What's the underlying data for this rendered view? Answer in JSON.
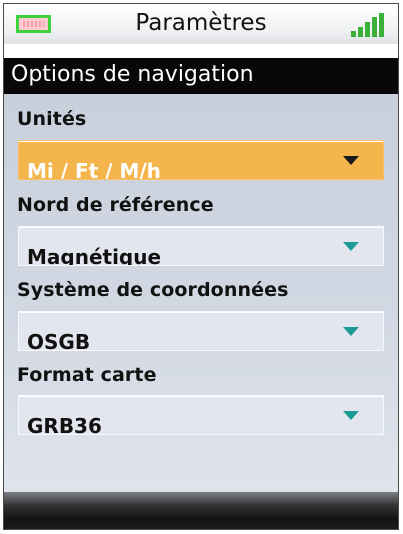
{
  "statusbar": {
    "title": "Paramètres",
    "battery_icon": "battery-icon",
    "signal_icon": "signal-strength-icon",
    "signal_bars": 5
  },
  "section": {
    "title": "Options de navigation"
  },
  "fields": [
    {
      "label": "Unités",
      "value": "Mi / Ft / M/h",
      "selected": true
    },
    {
      "label": "Nord de référence",
      "value": "Magnétique",
      "selected": false
    },
    {
      "label": "Système de coordonnées",
      "value": "OSGB",
      "selected": false
    },
    {
      "label": "Format carte",
      "value": "GRB36",
      "selected": false
    }
  ],
  "colors": {
    "highlight": "#f4b64c",
    "arrow": "#1f9b96",
    "signal": "#3ab03a",
    "battery_border": "#3fd23f"
  }
}
